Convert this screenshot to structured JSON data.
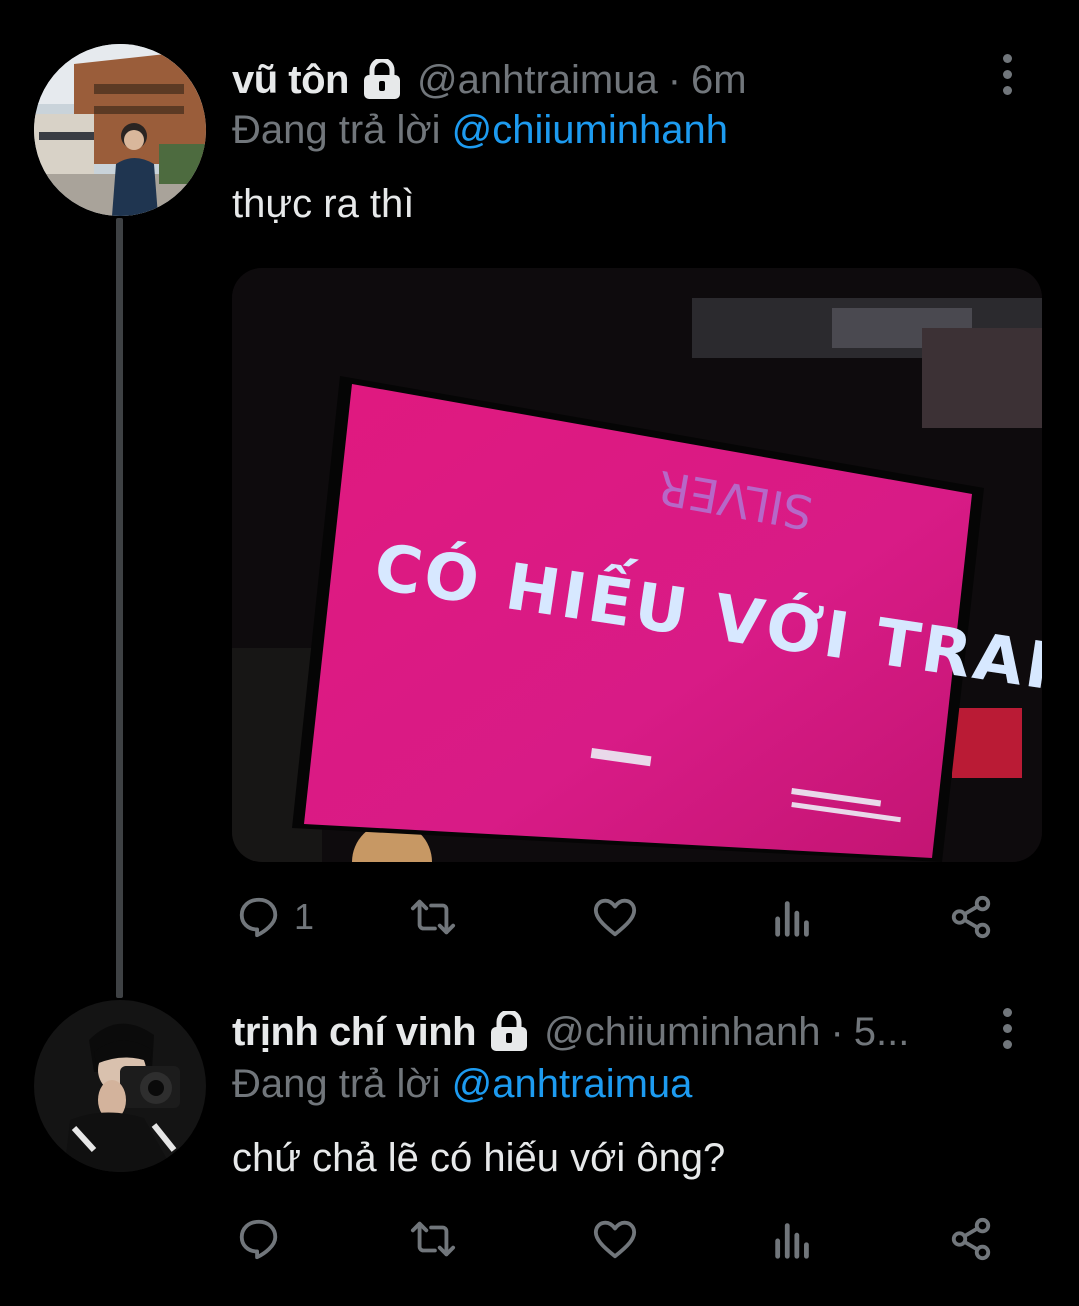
{
  "tweets": [
    {
      "display_name": "vũ tôn",
      "handle": "@anhtraimua",
      "separator": "·",
      "time": "6m",
      "reply_prefix": "Đang trả lời",
      "reply_to": "@chiiuminhanh",
      "text": "thực ra thì",
      "media": {
        "sign_text": "CÓ HIẾU VỚI TRAI.",
        "mirrored_text": "SILVER",
        "sign_color": "#e0197f"
      },
      "reply_count": "1",
      "icons": [
        "lock-icon",
        "more-icon",
        "reply-icon",
        "retweet-icon",
        "like-icon",
        "analytics-icon",
        "share-icon"
      ]
    },
    {
      "display_name": "trịnh chí vinh",
      "handle": "@chiiuminhanh",
      "separator": "·",
      "time": "5...",
      "reply_prefix": "Đang trả lời",
      "reply_to": "@anhtraimua",
      "text": "chứ chả lẽ có hiếu với ông?",
      "reply_count": "",
      "icons": [
        "lock-icon",
        "more-icon",
        "reply-icon",
        "retweet-icon",
        "like-icon",
        "analytics-icon",
        "share-icon"
      ]
    }
  ],
  "colors": {
    "background": "#000000",
    "text": "#e7e9ea",
    "secondary": "#71767b",
    "link": "#1d9bf0",
    "thread_line": "#3e4144"
  }
}
